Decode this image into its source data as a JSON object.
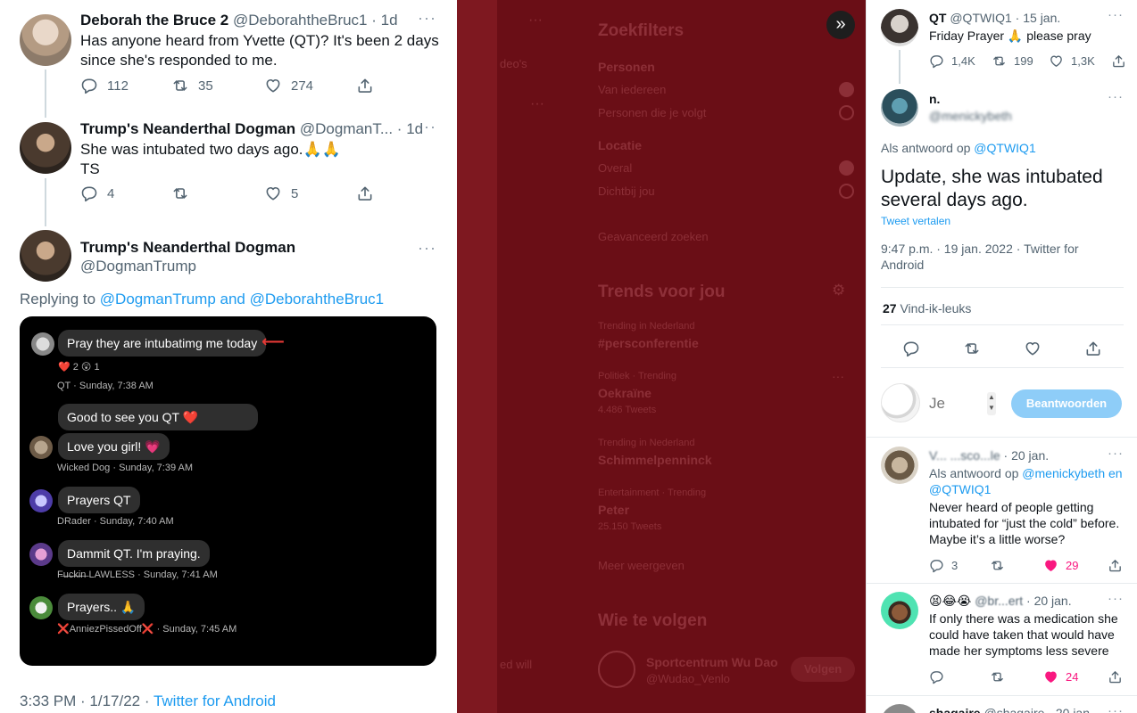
{
  "left": {
    "tweet1": {
      "name": "Deborah the Bruce 2",
      "handle": "@DeborahtheBruc1",
      "time": "1d",
      "text": "Has anyone heard from Yvette (QT)? It's been 2 days since she's responded to me.",
      "replies": "112",
      "retweets": "35",
      "likes": "274"
    },
    "tweet2": {
      "name": "Trump's Neanderthal Dogman",
      "handle": "@DogmanT...",
      "time": "1d",
      "text": "She was intubated two days ago.🙏🙏",
      "text2": "TS",
      "replies": "4",
      "retweets": "",
      "likes": "5"
    },
    "tweet3": {
      "name": "Trump's Neanderthal Dogman",
      "handle": "@DogmanTrump",
      "replying_label": "Replying to",
      "replying_to": "@DogmanTrump and @DeborahtheBruc1",
      "timestamp": "3:33 PM · 1/17/22 ·",
      "source": "Twitter for Android"
    },
    "chat": {
      "msg1": "Pray they are intubatimg me today",
      "react1": "❤️ 2 😲 1",
      "meta1": "QT · Sunday, 7:38 AM",
      "msg2": "Good to see you QT ❤️",
      "msg3": "Love you girl! 💗",
      "meta3": "Wicked Dog · Sunday, 7:39 AM",
      "msg4": "Prayers QT",
      "meta4": "DRader · Sunday, 7:40 AM",
      "msg5": "Dammit QT. I'm praying.",
      "meta5": "F̶u̶c̶k̶i̶n̶ LAWLESS · Sunday, 7:41 AM",
      "msg6": "Prayers.. 🙏",
      "meta6": "❌AnniezPissedOff❌ · Sunday, 7:45 AM"
    }
  },
  "middle": {
    "partial1": "deo's",
    "filters_title": "Zoekfilters",
    "people_label": "Personen",
    "people_opt1": "Van iedereen",
    "people_opt2": "Personen die je volgt",
    "location_label": "Locatie",
    "loc_opt1": "Overal",
    "loc_opt2": "Dichtbij jou",
    "advanced": "Geavanceerd zoeken",
    "trends_title": "Trends voor jou",
    "trend1_meta": "Trending in Nederland",
    "trend1_name": "#persconferentie",
    "trend2_meta": "Politiek · Trending",
    "trend2_name": "Oekraïne",
    "trend2_count": "4.486 Tweets",
    "trend3_meta": "Trending in Nederland",
    "trend3_name": "Schimmelpenninck",
    "trend4_meta": "Entertainment · Trending",
    "trend4_name": "Peter",
    "trend4_count": "25.150 Tweets",
    "show_more": "Meer weergeven",
    "follow_title": "Wie te volgen",
    "follow_name": "Sportcentrum Wu Dao",
    "follow_handle": "@Wudao_Venlo",
    "follow_btn": "Volgen",
    "partial2": "ed will"
  },
  "right": {
    "t1": {
      "name": "QT",
      "handle": "@QTWIQ1",
      "time": "15 jan.",
      "text": "Friday Prayer 🙏 please pray",
      "replies": "1,4K",
      "retweets": "199",
      "likes": "1,3K"
    },
    "main": {
      "name": "n.",
      "handle": "@menickybeth",
      "reply_label": "Als antwoord op",
      "reply_to": "@QTWIQ1",
      "text": "Update, she was intubated several days ago.",
      "translate": "Tweet vertalen",
      "timestamp": "9:47 p.m. · 19 jan. 2022 · Twitter for Android",
      "likes_count": "27",
      "likes_label": "Vind-ik-leuks"
    },
    "compose": {
      "placeholder": "Je",
      "button": "Beantwoorden"
    },
    "r1": {
      "name": "V... ...sco...le",
      "time": "20 jan.",
      "reply_label": "Als antwoord op",
      "reply_to": "@menickybeth en @QTWIQ1",
      "text": "Never heard of people getting intubated for “just the cold” before. Maybe it’s a little worse?",
      "replies": "3",
      "likes": "29"
    },
    "r2": {
      "name": "😫😂😭",
      "handle": "@br...ert",
      "time": "20 jan.",
      "text": "If only there was a medication she could have taken that would have made her symptoms less severe",
      "likes": "24"
    },
    "r3": {
      "name": "shagaire",
      "handle": "@shagaire",
      "time": "20 jan."
    }
  }
}
